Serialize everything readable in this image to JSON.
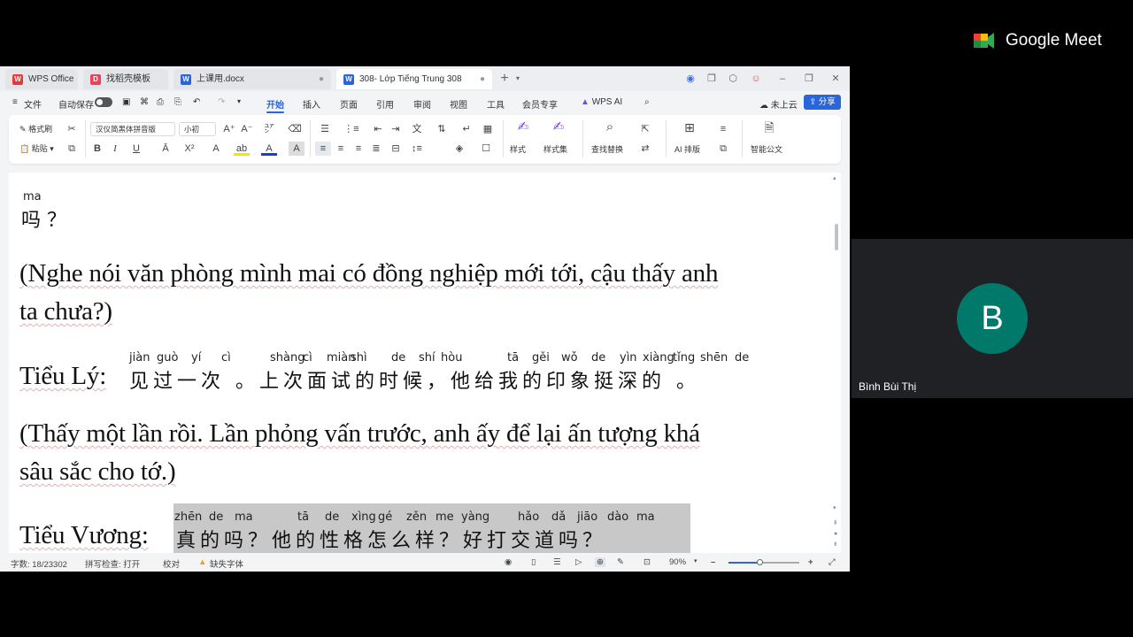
{
  "meet": {
    "brand": "Google Meet",
    "participant_initial": "B",
    "participant_name": "Bình Bùi Thị",
    "avatar_color": "#00796b"
  },
  "wps": {
    "tabs": [
      {
        "label": "WPS Office",
        "icon": "wps-logo-icon"
      },
      {
        "label": "找稻壳模板",
        "icon": "docer-icon"
      },
      {
        "label": "上课用.docx",
        "icon": "word-doc-icon"
      },
      {
        "label": "308- Lớp Tiếng Trung 308",
        "icon": "word-doc-icon"
      }
    ],
    "menu": {
      "file": "文件",
      "autosave": "自动保存",
      "items": [
        "开始",
        "插入",
        "页面",
        "引用",
        "审阅",
        "视图",
        "工具",
        "会员专享"
      ],
      "wps_ai": "WPS AI",
      "cloud": "未上云",
      "share": "分享"
    },
    "ribbon": {
      "format_painter": "格式刷",
      "paste": "粘贴",
      "font_name": "汉仪简黑体拼音版",
      "font_size": "小初",
      "styles": "样式",
      "style_set": "样式集",
      "find_replace": "查找替换",
      "ai_layout": "AI 排版",
      "smart_doc": "智能公文"
    },
    "status": {
      "word_count": "字数: 18/23302",
      "spell_check": "拼写检查: 打开",
      "proofread": "校对",
      "missing_font": "缺失字体",
      "zoom": "90%"
    },
    "accent": "#2a65d9"
  },
  "document": {
    "line1": {
      "pinyin": "ma",
      "hanzi": "吗",
      "punct": "？"
    },
    "translation1_line1": "(Nghe nói văn phòng mình mai có đồng nghiệp mới tới, cậu thấy anh",
    "translation1_line2": "ta chưa?)",
    "speaker1": "Tiểu Lý:",
    "speaker1_pinyin": [
      "jiàn",
      "guò",
      "yí",
      "cì",
      "shàng",
      "cì",
      "miàn",
      "shì",
      "de",
      "shí",
      "hòu",
      "tā",
      "gěi",
      "wǒ",
      "de",
      "yìn",
      "xiàng",
      "tǐng",
      "shēn",
      "de"
    ],
    "speaker1_hanzi": "见过一次 。上次面试的时候，他给我的印象挺深的 。",
    "translation2_line1": "(Thấy một lần rồi. Lần phỏng vấn trước, anh ấy để lại ấn tượng khá",
    "translation2_line2": "sâu sắc cho tớ.)",
    "speaker2": "Tiểu Vương:",
    "speaker2_pinyin": [
      "zhēn",
      "de",
      "ma",
      "tā",
      "de",
      "xìng",
      "gé",
      "zěn",
      "me",
      "yàng",
      "hǎo",
      "dǎ",
      "jiāo",
      "dào",
      "ma"
    ],
    "speaker2_hanzi": "真的吗？他的性格怎么样？好打交道吗？"
  }
}
